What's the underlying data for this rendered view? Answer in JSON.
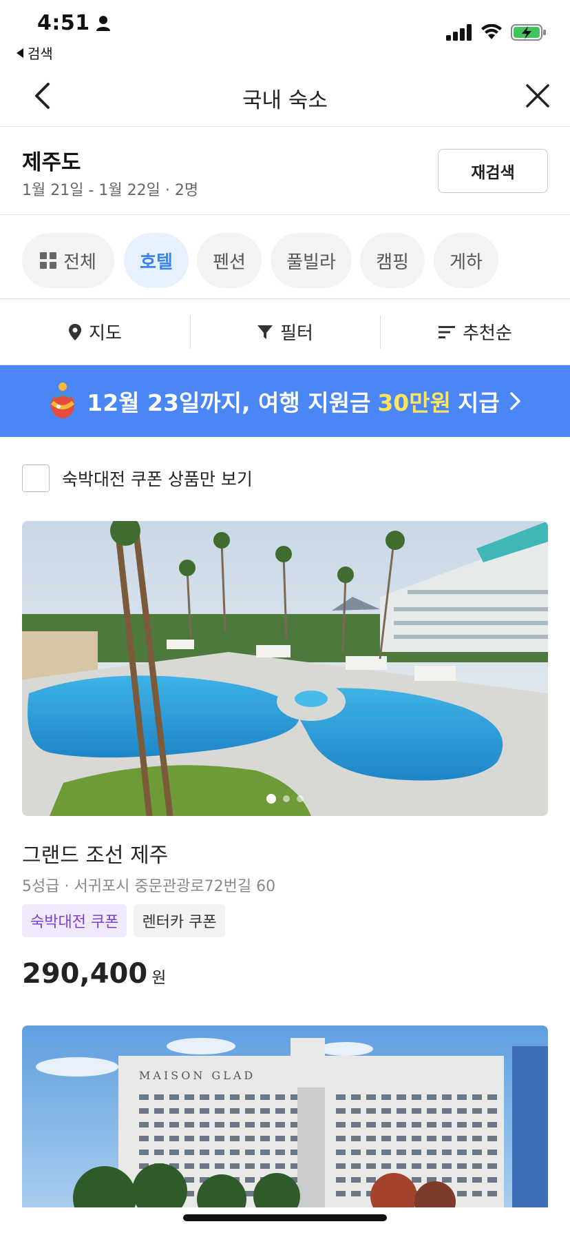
{
  "status_bar": {
    "time": "4:51",
    "back_app_label": "검색"
  },
  "nav": {
    "title": "국내 숙소"
  },
  "search": {
    "location": "제주도",
    "dates_guests": "1월 21일 - 1월 22일 · 2명",
    "research_label": "재검색"
  },
  "categories": [
    {
      "label": "전체",
      "active": false
    },
    {
      "label": "호텔",
      "active": true
    },
    {
      "label": "펜션",
      "active": false
    },
    {
      "label": "풀빌라",
      "active": false
    },
    {
      "label": "캠핑",
      "active": false
    },
    {
      "label": "게하",
      "active": false
    }
  ],
  "toolbar": {
    "map_label": "지도",
    "filter_label": "필터",
    "sort_label": "추천순"
  },
  "banner": {
    "text_before": "12월 23일까지, 여행 지원금",
    "highlight": "30만원",
    "text_after": "지급",
    "highlight_color": "#ffe45c",
    "background_color": "#4a86f6"
  },
  "coupon_filter": {
    "label": "숙박대전 쿠폰 상품만 보기",
    "checked": false
  },
  "listings": [
    {
      "name": "그랜드 조선 제주",
      "address": "5성급 · 서귀포시 중문관광로72번길 60",
      "tags": [
        "숙박대전 쿠폰",
        "렌터카 쿠폰"
      ],
      "price": "290,400",
      "price_unit": "원",
      "photo_index": 1,
      "photo_count": 3
    },
    {
      "photo_sign": "MAISON GLAD"
    }
  ],
  "colors": {
    "accent_blue": "#3a85e8",
    "coupon_purple": "#7b3fd6"
  }
}
